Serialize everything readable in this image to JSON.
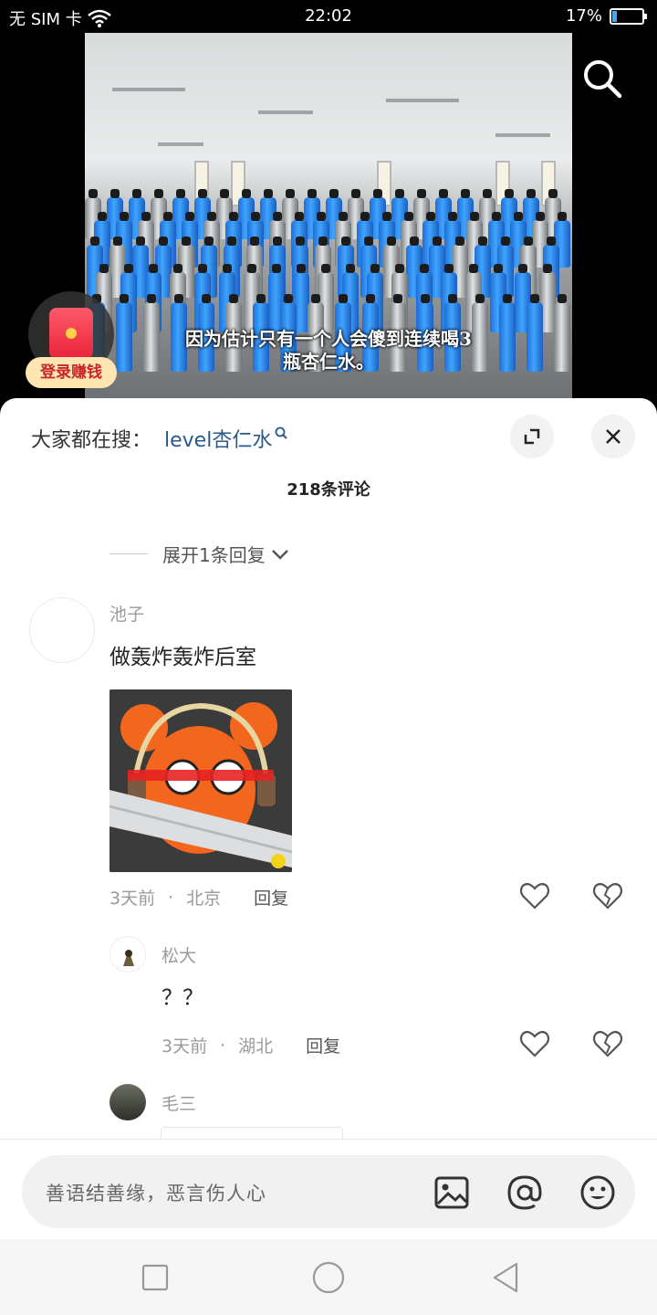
{
  "status_bar": {
    "carrier": "无 SIM 卡",
    "time": "22:02",
    "battery": "17%",
    "battery_level": 0.17
  },
  "video": {
    "subtitle_line1": "因为估计只有一个人会傻到连续喝3",
    "subtitle_line2": "瓶杏仁水。",
    "search_icon": "search-icon",
    "promo_label": "登录赚钱"
  },
  "panel": {
    "hot_search_label": "大家都在搜：",
    "hot_search_term": "level杏仁水",
    "comment_count": "218条评论",
    "expand_replies": "展开1条回复"
  },
  "comments": [
    {
      "user": "池子",
      "text": "做轰炸轰炸后室",
      "time": "3天前",
      "location": "北京",
      "reply": "回复"
    },
    {
      "user": "松大",
      "text": "？？",
      "time": "3天前",
      "location": "湖北",
      "reply": "回复"
    },
    {
      "user": "毛三"
    }
  ],
  "meta_separator": "·",
  "input": {
    "placeholder": "善语结善缘，恶言伤人心"
  },
  "colors": {
    "link": "#285a8d",
    "promo_bg": "#ffe6b0",
    "promo_text": "#c6262c",
    "battery_fill": "#3fa9ff"
  }
}
